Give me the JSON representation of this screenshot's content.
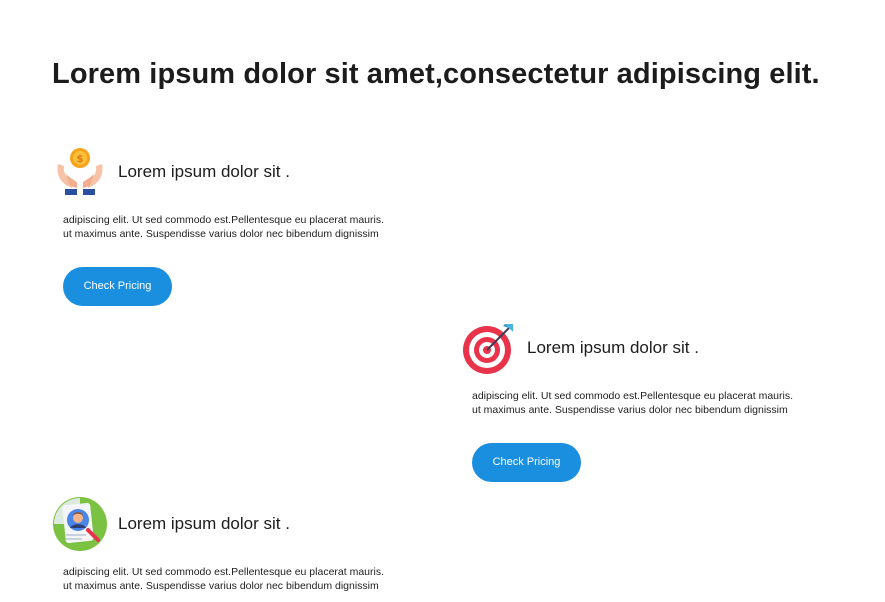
{
  "headline": "Lorem ipsum dolor sit amet,consectetur adipiscing elit.",
  "features": [
    {
      "icon": "hands-coin-icon",
      "title": "Lorem ipsum dolor sit .",
      "line1": "adipiscing elit. Ut sed commodo est.Pellentesque eu placerat mauris.",
      "line2": "ut maximus ante. Suspendisse varius dolor nec bibendum dignissim",
      "button_label": "Check Pricing"
    },
    {
      "icon": "target-dart-icon",
      "title": "Lorem ipsum dolor sit .",
      "line1": "adipiscing elit. Ut sed commodo est.Pellentesque eu placerat mauris.",
      "line2": "ut maximus ante. Suspendisse varius dolor nec bibendum dignissim",
      "button_label": "Check Pricing"
    },
    {
      "icon": "profile-search-icon",
      "title": "Lorem ipsum dolor sit .",
      "line1": "adipiscing elit. Ut sed commodo est.Pellentesque eu placerat mauris.",
      "line2": "ut maximus ante. Suspendisse varius dolor nec bibendum dignissim"
    }
  ],
  "colors": {
    "accent": "#1a8fe0",
    "text": "#1c1c1c",
    "background": "#ffffff"
  }
}
